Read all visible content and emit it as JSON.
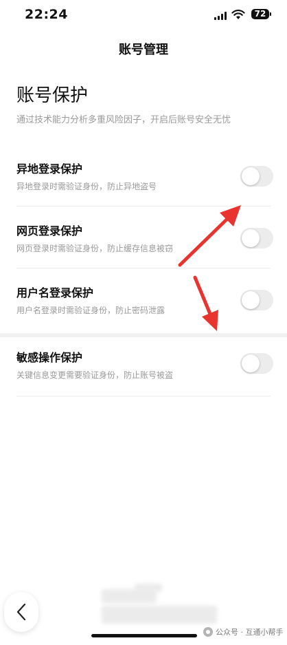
{
  "status_bar": {
    "time": "22:24",
    "battery": "72"
  },
  "nav": {
    "title": "账号管理"
  },
  "section": {
    "heading": "账号保护",
    "description": "通过技术能力分析多重风险因子，开启后账号安全无忧"
  },
  "settings": [
    {
      "title": "异地登录保护",
      "description": "异地登录时需验证身份，防止异地盗号",
      "enabled": false
    },
    {
      "title": "网页登录保护",
      "description": "网页登录时需验证身份，防止缓存信息被窃",
      "enabled": false
    },
    {
      "title": "用户名登录保护",
      "description": "用户名登录时需验证身份，防止密码泄露",
      "enabled": false
    },
    {
      "title": "敏感操作保护",
      "description": "关键信息变更需要验证身份，防止账号被盗",
      "enabled": false
    }
  ],
  "watermark": {
    "text": "公众号 · 互通小帮手"
  },
  "icons": {
    "back": "chevron-left-icon",
    "signal": "cellular-signal-icon",
    "wifi": "wifi-icon",
    "battery": "battery-icon",
    "watermark": "wechat-official-account-icon"
  },
  "colors": {
    "toggle_off": "#ececec",
    "annotation_arrow": "#e8332f",
    "secondary_text": "#9a9a9a"
  }
}
